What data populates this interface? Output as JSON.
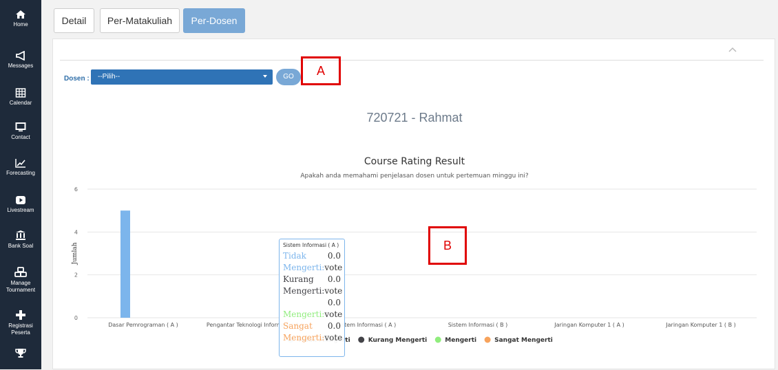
{
  "sidebar": {
    "items": [
      {
        "label": "Home",
        "icon": "home-icon"
      },
      {
        "label": "Messages",
        "icon": "megaphone-icon"
      },
      {
        "label": "Calendar",
        "icon": "calendar-icon"
      },
      {
        "label": "Contact",
        "icon": "monitor-icon"
      },
      {
        "label": "Forecasting",
        "icon": "line-chart-icon"
      },
      {
        "label": "Livestream",
        "icon": "play-icon"
      },
      {
        "label": "Bank Soal",
        "icon": "bank-icon"
      },
      {
        "label": "Manage",
        "label2": "Tournament",
        "icon": "cubes-icon"
      },
      {
        "label": "Registrasi",
        "label2": "Peserta",
        "icon": "plus-icon"
      },
      {
        "label": "",
        "icon": "trophy-icon"
      }
    ]
  },
  "tabs": [
    {
      "label": "Detail",
      "active": false
    },
    {
      "label": "Per-Matakuliah",
      "active": false
    },
    {
      "label": "Per-Dosen",
      "active": true
    }
  ],
  "filter": {
    "dosen_label": "Dosen :",
    "select_value": "--Pilih--",
    "go_label": "GO"
  },
  "annotations": {
    "a": "A",
    "b": "B"
  },
  "dosen_name": "720721 - Rahmat",
  "chart_data": {
    "type": "bar",
    "title": "Course Rating Result",
    "subtitle": "Apakah anda memahami penjelasan dosen untuk pertemuan minggu ini?",
    "ylabel": "Jumlah",
    "xlabel": "",
    "ylim": [
      0,
      6
    ],
    "yticks": [
      0,
      2,
      4,
      6
    ],
    "categories": [
      "Dasar Pemrograman ( A )",
      "Pengantar Teknologi Informasi ( A )",
      "Sistem Informasi ( A )",
      "Sistem Informasi ( B )",
      "Jaringan Komputer 1 ( A )",
      "Jaringan Komputer 1 ( B )"
    ],
    "series": [
      {
        "name": "Tidak Mengerti",
        "color": "#7cb5ec",
        "values": [
          5,
          0,
          0,
          0,
          0,
          0
        ]
      },
      {
        "name": "Kurang Mengerti",
        "color": "#434348",
        "values": [
          0,
          0,
          0,
          0,
          0,
          0
        ]
      },
      {
        "name": "Mengerti",
        "color": "#90ed7d",
        "values": [
          0,
          0,
          0,
          0,
          0,
          0
        ]
      },
      {
        "name": "Sangat Mengerti",
        "color": "#f7a35c",
        "values": [
          0,
          0,
          0,
          0,
          0,
          0
        ]
      }
    ],
    "grid": true,
    "legend": "bottom"
  },
  "tooltip": {
    "header": "Sistem Informasi ( A )",
    "rows": [
      {
        "line1": "Tidak",
        "line2": "Mengerti:",
        "value": "0.0",
        "unit": "vote",
        "color": "#7cb5ec"
      },
      {
        "line1": "Kurang",
        "line2": "Mengerti:",
        "value": "0.0",
        "unit": "vote",
        "color": "#434348"
      },
      {
        "line1": "",
        "line2": "Mengerti:",
        "value": "0.0",
        "unit": "vote",
        "color": "#90ed7d"
      },
      {
        "line1": "Sangat",
        "line2": "Mengerti:",
        "value": "0.0",
        "unit": "vote",
        "color": "#f7a35c"
      }
    ]
  }
}
